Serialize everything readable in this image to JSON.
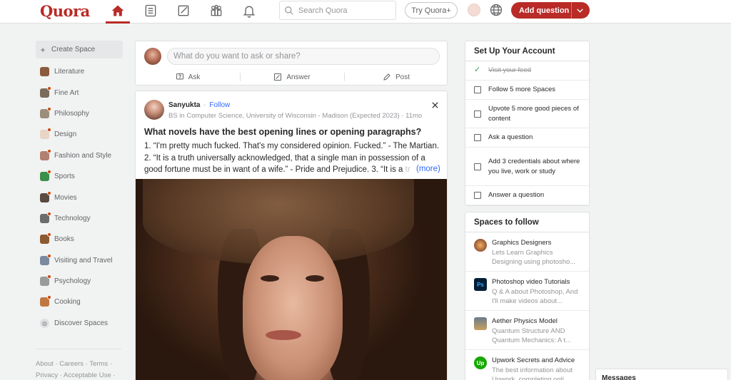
{
  "header": {
    "logo": "Quora",
    "search_placeholder": "Search Quora",
    "try_plus": "Try Quora+",
    "add_question": "Add question"
  },
  "colors": {
    "brand": "#b92b27",
    "link": "#2e69ff",
    "muted": "#939598"
  },
  "sidebar": {
    "create_space": "Create Space",
    "items": [
      {
        "label": "Literature",
        "icon": "literature-thumb",
        "has_dot": false
      },
      {
        "label": "Fine Art",
        "icon": "fine-art-thumb",
        "has_dot": true
      },
      {
        "label": "Philosophy",
        "icon": "philosophy-thumb",
        "has_dot": true
      },
      {
        "label": "Design",
        "icon": "design-thumb",
        "has_dot": true
      },
      {
        "label": "Fashion and Style",
        "icon": "fashion-thumb",
        "has_dot": true
      },
      {
        "label": "Sports",
        "icon": "sports-thumb",
        "has_dot": true
      },
      {
        "label": "Movies",
        "icon": "movies-thumb",
        "has_dot": true
      },
      {
        "label": "Technology",
        "icon": "technology-thumb",
        "has_dot": true
      },
      {
        "label": "Books",
        "icon": "books-thumb",
        "has_dot": true
      },
      {
        "label": "Visiting and Travel",
        "icon": "travel-thumb",
        "has_dot": true
      },
      {
        "label": "Psychology",
        "icon": "psychology-thumb",
        "has_dot": true
      },
      {
        "label": "Cooking",
        "icon": "cooking-thumb",
        "has_dot": true
      }
    ],
    "discover": "Discover Spaces",
    "footer_line1": "About · Careers · Terms ·",
    "footer_line2": "Privacy · Acceptable Use ·"
  },
  "ask_box": {
    "placeholder": "What do you want to ask or share?",
    "ask": "Ask",
    "answer": "Answer",
    "post": "Post"
  },
  "post": {
    "author": "Sanyukta",
    "follow": "Follow",
    "credential": "BS in Computer Science, University of Wisconsin - Madison (Expected 2023) · 11mo",
    "question": "What novels have the best opening lines or opening paragraphs?",
    "answer_text": "1. “I'm pretty much fucked. That's my considered opinion. Fucked.” - The Martian. 2. “It is a truth universally acknowledged, that a single man in possession of a good fortune must be in want of a wife.” - Pride and Prejudice. 3. “It is a",
    "answer_fade": " tr",
    "more": "(more)"
  },
  "setup": {
    "title": "Set Up Your Account",
    "items": [
      {
        "label": "Visit your feed",
        "done": true
      },
      {
        "label": "Follow 5 more Spaces",
        "done": false
      },
      {
        "label": "Upvote 5 more good pieces of content",
        "done": false
      },
      {
        "label": "Ask a question",
        "done": false
      },
      {
        "label": "Add 3 credentials about where you live, work or study",
        "done": false
      },
      {
        "label": "Answer a question",
        "done": false
      }
    ]
  },
  "spaces_to_follow": {
    "title": "Spaces to follow",
    "items": [
      {
        "name": "Graphics Designers",
        "desc": "Lets Learn Graphics Designing using photosho...",
        "icon": "graphics-designers-icon"
      },
      {
        "name": "Photoshop video Tutorials",
        "desc": "Q & A about Photoshop, And I'll make videos about...",
        "icon": "photoshop-icon",
        "icon_text": "Ps"
      },
      {
        "name": "Aether Physics Model",
        "desc": "Quantum Structure AND Quantum Mechanics: A t...",
        "icon": "aether-physics-icon"
      },
      {
        "name": "Upwork Secrets and Advice",
        "desc": "The best information about Upwork, completing onli...",
        "icon": "upwork-icon",
        "icon_text": "Up"
      }
    ]
  },
  "messages": {
    "title": "Messages"
  }
}
